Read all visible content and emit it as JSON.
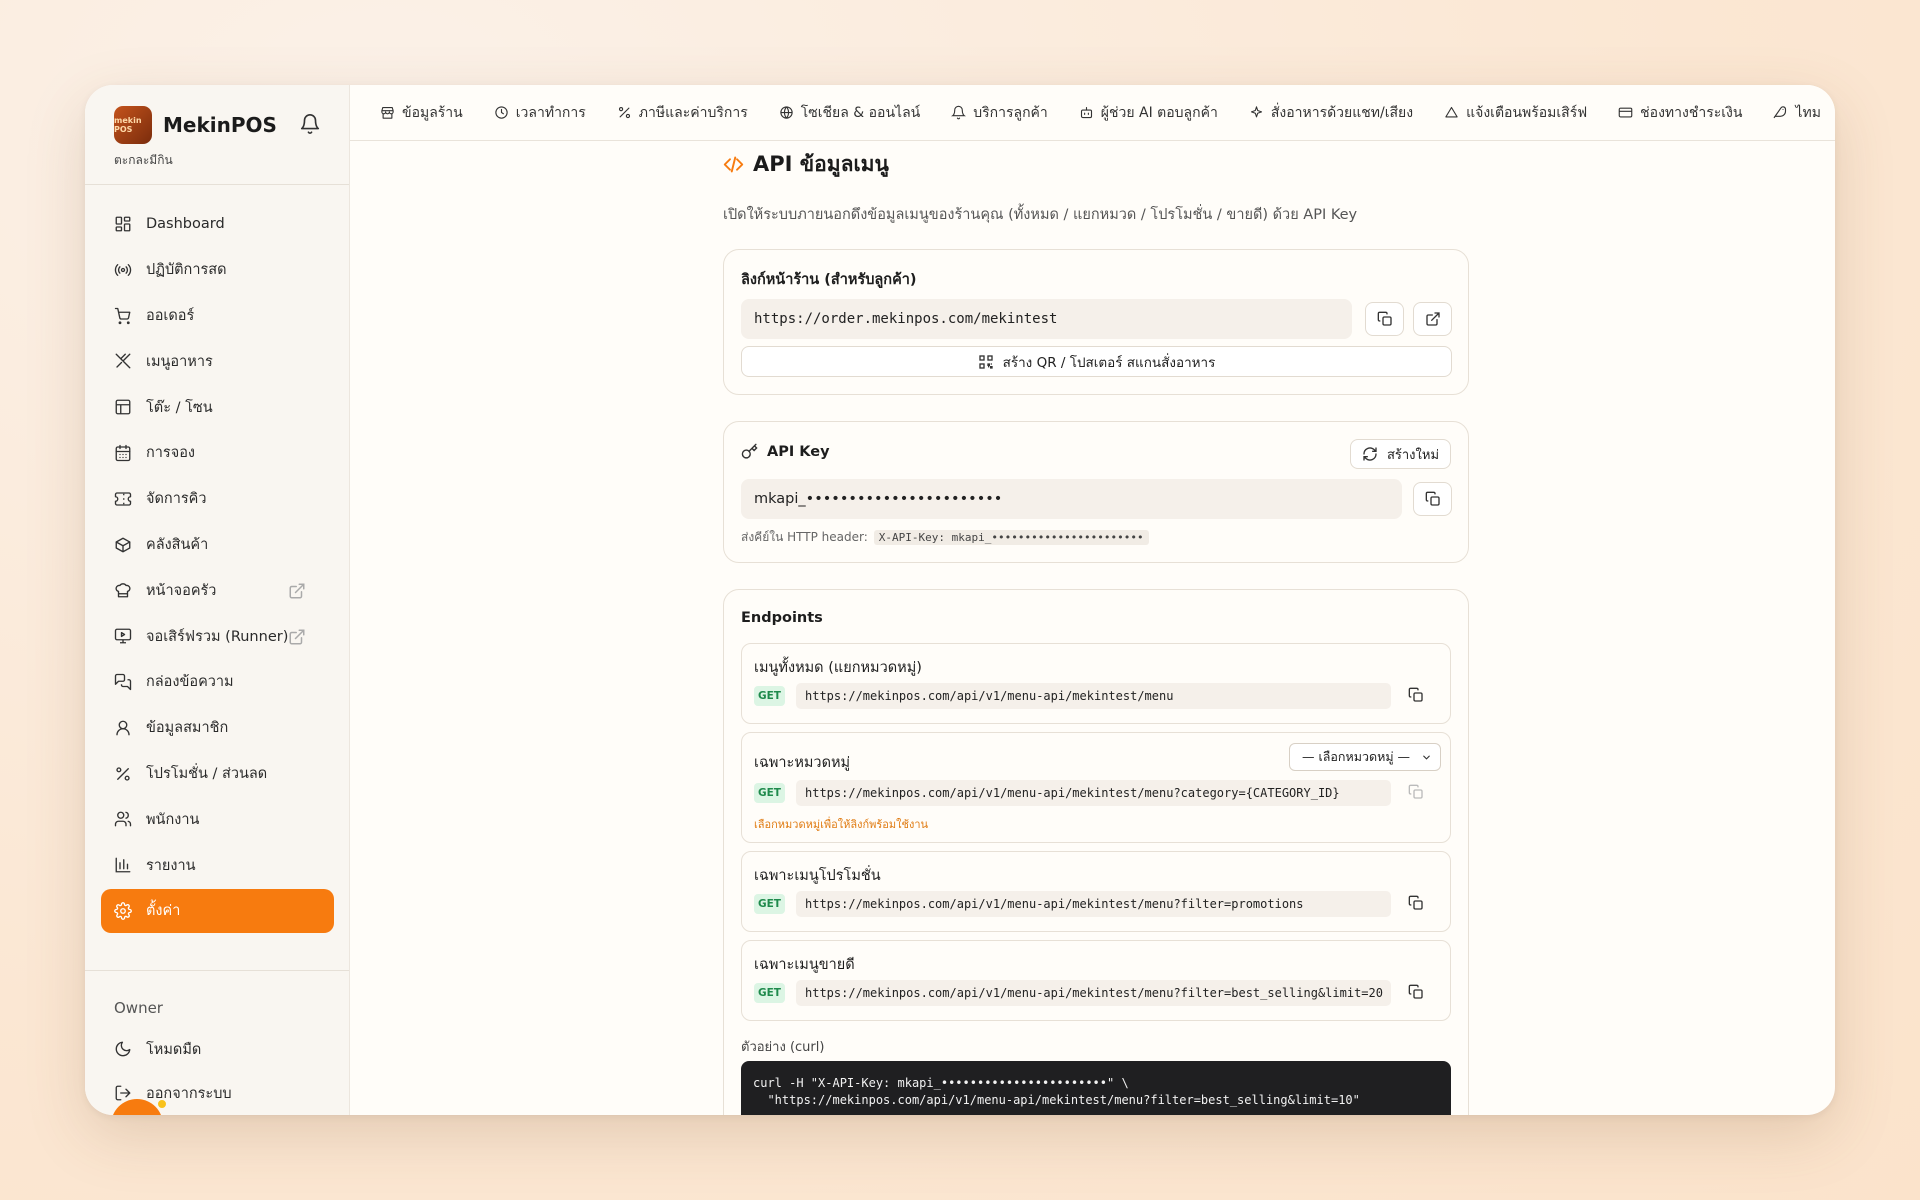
{
  "brand": {
    "name": "MekinPOS",
    "logo_text": "mekin POS",
    "store_name": "ตะกละมีกิน"
  },
  "sidebar": {
    "items": [
      {
        "label": "Dashboard",
        "icon": "dashboard-icon"
      },
      {
        "label": "ปฏิบัติการสด",
        "icon": "broadcast-icon"
      },
      {
        "label": "ออเดอร์",
        "icon": "cart-icon"
      },
      {
        "label": "เมนูอาหาร",
        "icon": "utensils-icon"
      },
      {
        "label": "โต๊ะ / โซน",
        "icon": "table-icon"
      },
      {
        "label": "การจอง",
        "icon": "calendar-icon"
      },
      {
        "label": "จัดการคิว",
        "icon": "ticket-icon"
      },
      {
        "label": "คลังสินค้า",
        "icon": "box-icon"
      },
      {
        "label": "หน้าจอครัว",
        "icon": "chef-hat-icon",
        "external": true
      },
      {
        "label": "จอเสิร์ฟรวม (Runner)",
        "icon": "monitor-play-icon",
        "external": true
      },
      {
        "label": "กล่องข้อความ",
        "icon": "chat-icon"
      },
      {
        "label": "ข้อมูลสมาชิก",
        "icon": "user-icon"
      },
      {
        "label": "โปรโมชั่น / ส่วนลด",
        "icon": "percent-icon"
      },
      {
        "label": "พนักงาน",
        "icon": "users-icon"
      },
      {
        "label": "รายงาน",
        "icon": "bar-chart-icon"
      },
      {
        "label": "ตั้งค่า",
        "icon": "gear-icon",
        "active": true
      }
    ],
    "role": "Owner",
    "dark_mode_label": "โหมดมืด",
    "logout_label": "ออกจากระบบ"
  },
  "tabs": [
    {
      "label": "ข้อมูลร้าน",
      "icon": "store-icon"
    },
    {
      "label": "เวลาทำการ",
      "icon": "clock-icon"
    },
    {
      "label": "ภาษีและค่าบริการ",
      "icon": "percent-icon"
    },
    {
      "label": "โซเชียล & ออนไลน์",
      "icon": "globe-icon"
    },
    {
      "label": "บริการลูกค้า",
      "icon": "bell-icon"
    },
    {
      "label": "ผู้ช่วย AI ตอบลูกค้า",
      "icon": "bot-icon"
    },
    {
      "label": "สั่งอาหารด้วยแชท/เสียง",
      "icon": "sparkles-icon"
    },
    {
      "label": "แจ้งเตือนพร้อมเสิร์ฟ",
      "icon": "cloche-icon"
    },
    {
      "label": "ช่องทางชำระเงิน",
      "icon": "credit-card-icon"
    },
    {
      "label": "ไทม",
      "icon": "bird-icon"
    }
  ],
  "page": {
    "title": "API ข้อมูลเมนู",
    "description": "เปิดให้ระบบภายนอกดึงข้อมูลเมนูของร้านคุณ (ทั้งหมด / แยกหมวด / โปรโมชั่น / ขายดี) ด้วย API Key"
  },
  "storefront": {
    "title": "ลิงก์หน้าร้าน (สำหรับลูกค้า)",
    "url": "https://order.mekinpos.com/mekintest",
    "qr_button": "สร้าง QR / โปสเตอร์ สแกนสั่งอาหาร"
  },
  "api_key": {
    "title": "API Key",
    "regenerate": "สร้างใหม่",
    "value": "mkapi_•••••••••••••••••••••••",
    "hint_label": "ส่งคีย์ใน HTTP header:",
    "hint_code": "X-API-Key: mkapi_•••••••••••••••••••••••"
  },
  "endpoints": {
    "title": "Endpoints",
    "items": [
      {
        "title": "เมนูทั้งหมด (แยกหมวดหมู่)",
        "method": "GET",
        "url": "https://mekinpos.com/api/v1/menu-api/mekintest/menu"
      },
      {
        "title": "เฉพาะหมวดหมู่",
        "method": "GET",
        "url": "https://mekinpos.com/api/v1/menu-api/mekintest/menu?category={CATEGORY_ID}",
        "select_value": "— เลือกหมวดหมู่ —",
        "hint": "เลือกหมวดหมู่เพื่อให้ลิงก์พร้อมใช้งาน"
      },
      {
        "title": "เฉพาะเมนูโปรโมชั่น",
        "method": "GET",
        "url": "https://mekinpos.com/api/v1/menu-api/mekintest/menu?filter=promotions"
      },
      {
        "title": "เฉพาะเมนูขายดี",
        "method": "GET",
        "url": "https://mekinpos.com/api/v1/menu-api/mekintest/menu?filter=best_selling&limit=20"
      }
    ]
  },
  "curl": {
    "label": "ตัวอย่าง (curl)",
    "line1": "curl -H \"X-API-Key: mkapi_•••••••••••••••••••••••\" \\",
    "line2": "  \"https://mekinpos.com/api/v1/menu-api/mekintest/menu?filter=best_selling&limit=10\""
  },
  "colors": {
    "accent": "#f77b0f",
    "get_badge_bg": "#dcf5e4",
    "get_badge_text": "#1f8a4c",
    "hint_orange": "#e07b12"
  }
}
